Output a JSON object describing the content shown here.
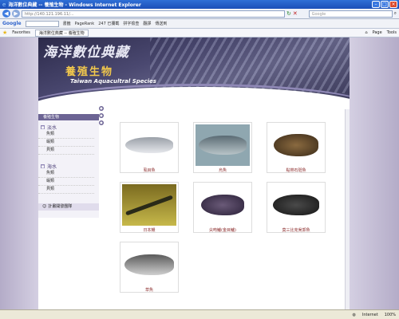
{
  "window": {
    "title": "海洋數位典藏 -- 養殖生物 - Windows Internet Explorer"
  },
  "address": {
    "url": "http://140.121.196.11/...",
    "search_placeholder": "Google"
  },
  "toolbar": {
    "google": "Google",
    "items": [
      "書籤",
      "PageRank",
      "247 已攔截",
      "拼字檢查",
      "翻譯",
      "傳送到"
    ]
  },
  "favorites": {
    "label": "Favorites",
    "tab": "海洋數位典藏 -- 養殖生物",
    "right": [
      "Page",
      "Tools"
    ]
  },
  "banner": {
    "line1": "海洋數位典藏",
    "line2": "養殖生物",
    "line3": "Taiwan Aquacultral Species"
  },
  "menu": {
    "head": "養殖生物",
    "freshwater": {
      "label": "淡水",
      "items": [
        "魚類",
        "蝦類",
        "貝類"
      ]
    },
    "seawater": {
      "label": "海水",
      "items": [
        "魚類",
        "蝦類",
        "貝類"
      ]
    },
    "team": "計畫開發團隊"
  },
  "gallery": [
    {
      "name": "虱目魚"
    },
    {
      "name": "烏魚"
    },
    {
      "name": "點帶石斑魚"
    },
    {
      "name": "日本鰻"
    },
    {
      "name": "尖吻鱸(金目鱸)"
    },
    {
      "name": "莫三比克吳郭魚"
    },
    {
      "name": "草魚"
    }
  ],
  "status": {
    "left": "",
    "zone": "Internet",
    "zoom": "100%"
  }
}
